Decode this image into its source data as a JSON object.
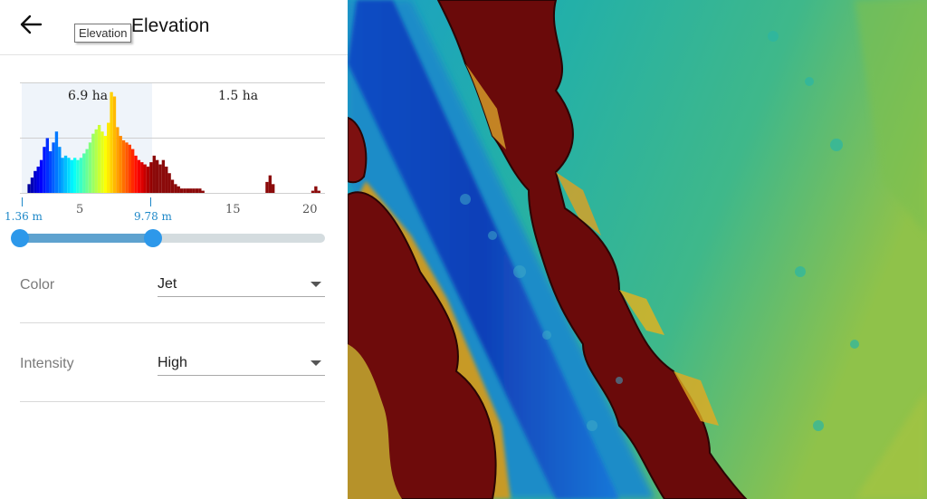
{
  "header": {
    "title": "Elevation",
    "tooltip": "Elevation",
    "back_icon": "arrow-left-icon"
  },
  "histogram": {
    "selected_area": "6.9 ha",
    "unselected_area": "1.5 ha",
    "axis_ticks": [
      "5",
      "15",
      "20"
    ],
    "range_min_label": "1.36 m",
    "range_max_label": "9.78 m"
  },
  "chart_data": {
    "type": "bar",
    "xlim": [
      1,
      21
    ],
    "colormap": "jet",
    "x": [
      1.6,
      1.8,
      2.0,
      2.2,
      2.4,
      2.6,
      2.8,
      3.0,
      3.2,
      3.4,
      3.6,
      3.8,
      4.0,
      4.2,
      4.4,
      4.6,
      4.8,
      5.0,
      5.2,
      5.4,
      5.6,
      5.8,
      6.0,
      6.2,
      6.4,
      6.6,
      6.8,
      7.0,
      7.2,
      7.4,
      7.6,
      7.8,
      8.0,
      8.2,
      8.4,
      8.6,
      8.8,
      9.0,
      9.2,
      9.4,
      9.6,
      9.8,
      10.0,
      10.2,
      10.4,
      10.6,
      10.8,
      11.0,
      11.2,
      11.4,
      11.6,
      11.8,
      12.0,
      12.2,
      12.4,
      12.6,
      12.8,
      13.0,
      17.2,
      17.4,
      17.6,
      20.2,
      20.4,
      20.6
    ],
    "values": [
      8,
      14,
      20,
      24,
      30,
      42,
      50,
      38,
      46,
      56,
      42,
      32,
      34,
      32,
      30,
      32,
      30,
      32,
      36,
      40,
      46,
      54,
      58,
      62,
      56,
      52,
      64,
      92,
      88,
      60,
      52,
      48,
      46,
      44,
      40,
      34,
      30,
      28,
      26,
      24,
      28,
      34,
      30,
      26,
      30,
      24,
      18,
      12,
      8,
      6,
      4,
      4,
      4,
      4,
      4,
      4,
      4,
      2,
      10,
      16,
      8,
      2,
      6,
      2
    ]
  },
  "slider": {
    "min": 1.36,
    "max": 20.6,
    "low": 1.36,
    "high": 9.78
  },
  "color": {
    "label": "Color",
    "value": "Jet"
  },
  "intensity": {
    "label": "Intensity",
    "value": "High"
  }
}
